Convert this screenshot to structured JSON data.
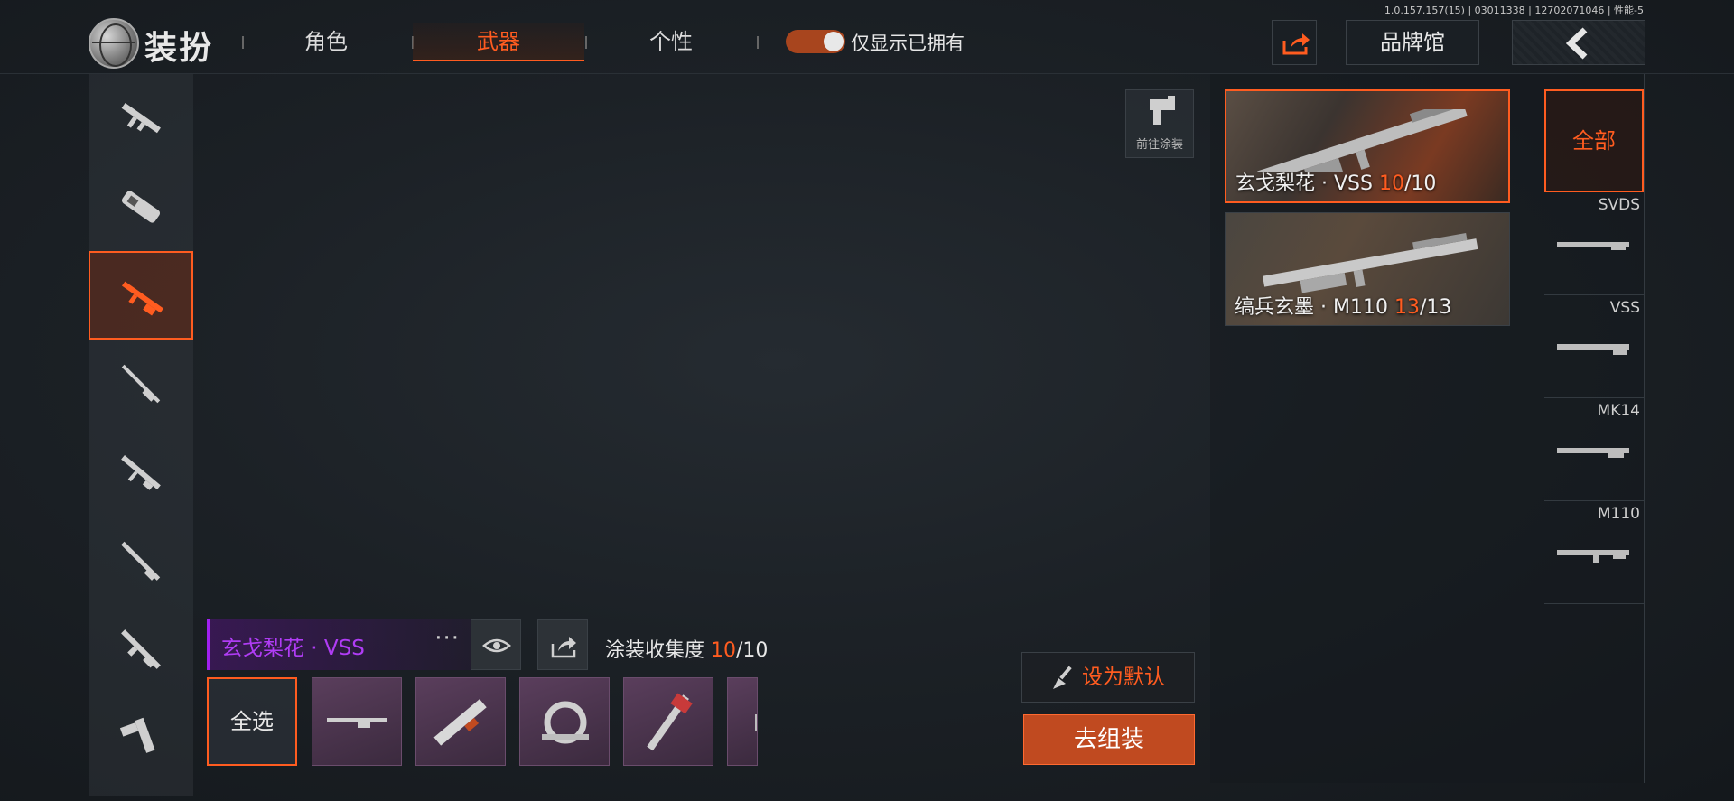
{
  "version": "1.0.157.157(15) | 03011338 | 12702071046 | 性能-5",
  "header": {
    "title": "装扮",
    "tabs": [
      {
        "label": "角色",
        "active": false
      },
      {
        "label": "武器",
        "active": true
      },
      {
        "label": "个性",
        "active": false
      }
    ],
    "owned_toggle": {
      "label": "仅显示已拥有",
      "on": true
    },
    "brand_label": "品牌馆",
    "share_icon": "share-icon",
    "back_icon": "back-chevron-icon"
  },
  "left_weapons": [
    {
      "icon": "assault-rifle-icon",
      "active": false
    },
    {
      "icon": "smg-p90-icon",
      "active": false
    },
    {
      "icon": "marksman-rifle-icon",
      "active": true
    },
    {
      "icon": "sniper-rifle-icon",
      "active": false
    },
    {
      "icon": "assault-rifle-icon",
      "active": false
    },
    {
      "icon": "shotgun-icon",
      "active": false
    },
    {
      "icon": "light-machine-gun-icon",
      "active": false
    },
    {
      "icon": "pistol-icon",
      "active": false
    }
  ],
  "paint_shortcut": {
    "label": "前往涂装",
    "icon": "spray-gun-icon"
  },
  "skins": [
    {
      "name": "玄戈梨花 · VSS",
      "owned": "10",
      "total": "/10",
      "selected": true
    },
    {
      "name": "缟兵玄墨 · M110",
      "owned": "13",
      "total": "/13",
      "selected": false
    }
  ],
  "categories": {
    "all_label": "全部",
    "items": [
      {
        "label": "SVDS"
      },
      {
        "label": "VSS"
      },
      {
        "label": "MK14"
      },
      {
        "label": "M110"
      }
    ]
  },
  "current_skin": {
    "name": "玄戈梨花 · VSS",
    "more": "···",
    "progress_label": "涂装收集度",
    "progress_owned": "10",
    "progress_total": "/10"
  },
  "parts": {
    "select_all_label": "全选",
    "items": [
      "vss-rifle-part",
      "stock-part",
      "scope-part",
      "barrel-part",
      "partial-part"
    ]
  },
  "actions": {
    "set_default_label": "设为默认",
    "assemble_label": "去组装"
  },
  "colors": {
    "accent": "#ff5c20",
    "skin_purple": "#b03cf5"
  }
}
